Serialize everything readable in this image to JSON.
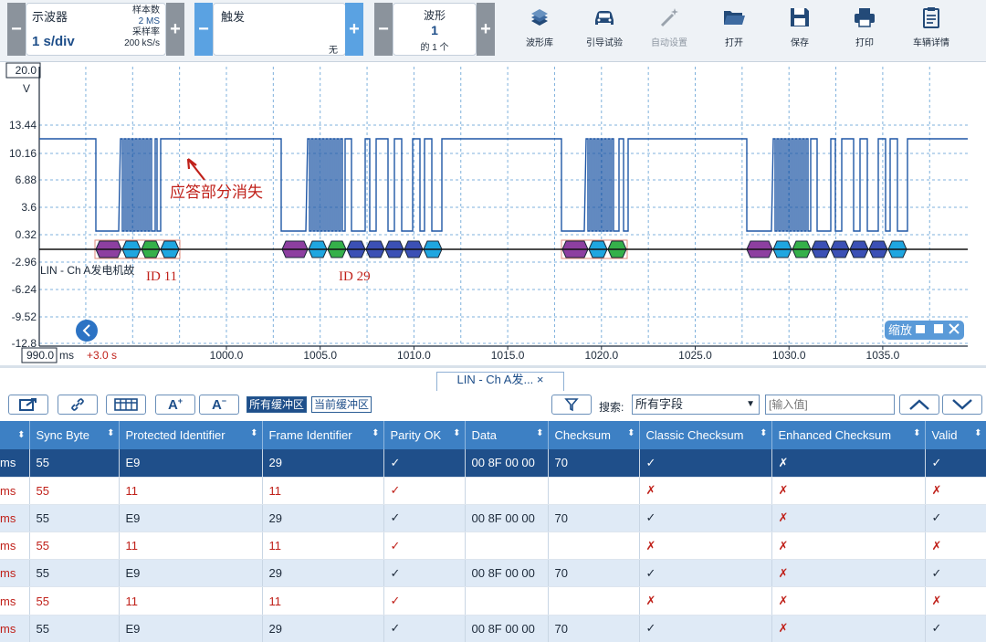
{
  "toolbar": {
    "scope": {
      "label": "示波器",
      "timebase": "1 s/div",
      "samples_label": "样本数",
      "samples": "2 MS",
      "rate_label": "采样率",
      "rate": "200 kS/s"
    },
    "trigger": {
      "label": "触发",
      "mode": "无"
    },
    "waveform": {
      "label": "波形",
      "index": "1",
      "count": "的 1 个"
    },
    "minus": "−",
    "plus": "+",
    "tools": [
      {
        "name": "waveform-library",
        "label": "波形库",
        "icon": "books-icon"
      },
      {
        "name": "guided-test",
        "label": "引导试验",
        "icon": "car-icon"
      },
      {
        "name": "auto-setup",
        "label": "自动设置",
        "icon": "wand-icon",
        "disabled": true
      },
      {
        "name": "open",
        "label": "打开",
        "icon": "folder-icon"
      },
      {
        "name": "save",
        "label": "保存",
        "icon": "floppy-icon"
      },
      {
        "name": "print",
        "label": "打印",
        "icon": "printer-icon"
      },
      {
        "name": "vehicle-details",
        "label": "车辆详情",
        "icon": "clipboard-icon"
      }
    ]
  },
  "scope": {
    "y_ticks": [
      "20.0",
      "V",
      "13.44",
      "10.16",
      "6.88",
      "3.6",
      "0.32",
      "-2.96",
      "-6.24",
      "-9.52",
      "-12.8"
    ],
    "x_ticks": [
      "990.0",
      "1000.0",
      "1005.0",
      "1010.0",
      "1015.0",
      "1020.0",
      "1025.0",
      "1030.0",
      "1035.0"
    ],
    "x_unit": "ms",
    "offset": "+3.0 s",
    "channel_label": "LIN - Ch A发电机故",
    "annotation": "应答部分消失",
    "id_labels": [
      "ID 11",
      "ID 29"
    ],
    "zoom_label": "缩放"
  },
  "colors": {
    "trace": "#1f57a6",
    "accent": "#3d80c4",
    "error": "#c0211a",
    "packet_purple": "#8d3fa0",
    "packet_cyan": "#1fa6e0",
    "packet_green": "#35b04a",
    "packet_blue": "#3b50b5"
  },
  "table_tab": {
    "label": "LIN - Ch A发...",
    "close": "×"
  },
  "filters": {
    "all_buffers": "所有缓冲区",
    "current_buffer": "当前缓冲区",
    "search_label": "搜索:",
    "search_field": "所有字段",
    "search_placeholder": "[输入值]"
  },
  "table": {
    "columns": [
      "",
      "Sync Byte",
      "Protected Identifier",
      "Frame Identifier",
      "Parity OK",
      "Data",
      "Checksum",
      "Classic Checksum",
      "Enhanced Checksum",
      "Valid"
    ],
    "rows": [
      {
        "time": "ms",
        "sync": "55",
        "pid": "E9",
        "fid": "29",
        "parity": "✓",
        "data": "00 8F 00 00",
        "checksum": "70",
        "classic": "✓",
        "enhanced": "✗",
        "valid": "✓"
      },
      {
        "time": "ms",
        "sync": "55",
        "pid": "11",
        "fid": "11",
        "parity": "✓",
        "data": "",
        "checksum": "",
        "classic": "✗",
        "enhanced": "✗",
        "valid": "✗"
      },
      {
        "time": "ms",
        "sync": "55",
        "pid": "E9",
        "fid": "29",
        "parity": "✓",
        "data": "00 8F 00 00",
        "checksum": "70",
        "classic": "✓",
        "enhanced": "✗",
        "valid": "✓"
      },
      {
        "time": "ms",
        "sync": "55",
        "pid": "11",
        "fid": "11",
        "parity": "✓",
        "data": "",
        "checksum": "",
        "classic": "✗",
        "enhanced": "✗",
        "valid": "✗"
      },
      {
        "time": "ms",
        "sync": "55",
        "pid": "E9",
        "fid": "29",
        "parity": "✓",
        "data": "00 8F 00 00",
        "checksum": "70",
        "classic": "✓",
        "enhanced": "✗",
        "valid": "✓"
      },
      {
        "time": "ms",
        "sync": "55",
        "pid": "11",
        "fid": "11",
        "parity": "✓",
        "data": "",
        "checksum": "",
        "classic": "✗",
        "enhanced": "✗",
        "valid": "✗"
      },
      {
        "time": "ms",
        "sync": "55",
        "pid": "E9",
        "fid": "29",
        "parity": "✓",
        "data": "00 8F 00 00",
        "checksum": "70",
        "classic": "✓",
        "enhanced": "✗",
        "valid": "✓"
      }
    ]
  }
}
